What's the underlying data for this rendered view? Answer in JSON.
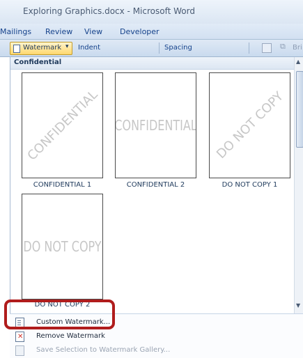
{
  "window": {
    "title": "Exploring Graphics.docx - Microsoft Word"
  },
  "ribbon": {
    "tabs": [
      "Mailings",
      "Review",
      "View",
      "Developer"
    ]
  },
  "toolbar": {
    "watermark_label": "Watermark",
    "watermark_caret": "▾",
    "indent_label": "Indent",
    "spacing_label": "Spacing",
    "truncated_label": "Bri"
  },
  "gallery": {
    "section_label": "Confidential",
    "items": [
      {
        "watermark": "CONFIDENTIAL",
        "caption": "CONFIDENTIAL 1",
        "style": "diagonal"
      },
      {
        "watermark": "CONFIDENTIAL",
        "caption": "CONFIDENTIAL 2",
        "style": "horizontal"
      },
      {
        "watermark": "DO NOT COPY",
        "caption": "DO NOT COPY 1",
        "style": "diagonal"
      },
      {
        "watermark": "DO NOT COPY",
        "caption": "DO NOT COPY 2",
        "style": "horizontal"
      }
    ]
  },
  "menu": {
    "items": [
      {
        "label": "Custom Watermark...",
        "icon": "document-icon",
        "enabled": true
      },
      {
        "label": "Remove Watermark",
        "icon": "remove-watermark-icon",
        "enabled": true
      },
      {
        "label": "Save Selection to Watermark Gallery...",
        "icon": "save-to-gallery-icon",
        "enabled": false
      }
    ]
  },
  "colors": {
    "highlight": "#b01c1c",
    "accent": "#ffd86e"
  }
}
